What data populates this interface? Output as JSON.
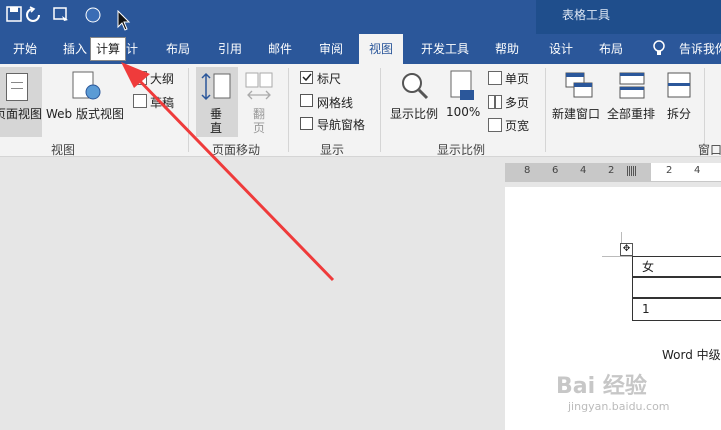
{
  "qat": {
    "more": "▾"
  },
  "context": {
    "group_title": "表格工具"
  },
  "tabs": [
    "开始",
    "插入",
    "计",
    "布局",
    "引用",
    "邮件",
    "审阅",
    "视图",
    "开发工具",
    "帮助",
    "设计",
    "布局",
    "告诉我你"
  ],
  "tooltip": "计算",
  "views": {
    "print_layout": "页面视图",
    "web_layout": "Web 版式视图",
    "outline": "大纲",
    "draft": "草稿",
    "group_label": "视图"
  },
  "page_movement": {
    "vertical": "垂直",
    "side_by_side": "翻页",
    "group_label": "页面移动"
  },
  "show": {
    "ruler": "标尺",
    "ruler_checked": true,
    "gridlines": "网格线",
    "nav_pane": "导航窗格",
    "group_label": "显示"
  },
  "zoom": {
    "zoom": "显示比例",
    "hundred": "100%",
    "one_page": "单页",
    "multi_page": "多页",
    "page_width": "页宽",
    "group_label": "显示比例"
  },
  "window": {
    "new_window": "新建窗口",
    "arrange_all": "全部重排",
    "split": "拆分",
    "group_label": "窗口"
  },
  "ruler_numbers": [
    "8",
    "6",
    "4",
    "2",
    "2",
    "4"
  ],
  "table": {
    "cells": [
      "女",
      "",
      "1"
    ]
  },
  "doc_text": "Word 中级",
  "watermark": {
    "logo": "Bai 经验",
    "url": "jingyan.baidu.com"
  }
}
